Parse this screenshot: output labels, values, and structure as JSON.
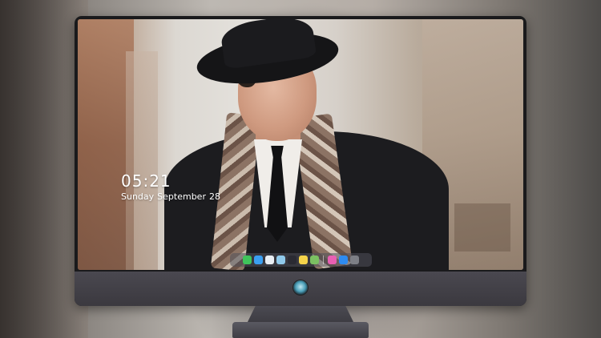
{
  "lockscreen": {
    "time": "05:21",
    "date_day": "Sunday",
    "date_month": "September",
    "date_num": "28"
  },
  "dock": {
    "icons": [
      {
        "name": "messages-icon",
        "color": "#3fc45b"
      },
      {
        "name": "finder-icon",
        "color": "#3b9ff0"
      },
      {
        "name": "safari-icon",
        "color": "#e9eef3"
      },
      {
        "name": "preview-icon",
        "color": "#8fc9ea"
      },
      {
        "name": "clapper-icon",
        "color": "#2b2b33"
      },
      {
        "name": "notes-icon",
        "color": "#f4d34a"
      },
      {
        "name": "photos-icon",
        "color": "#7bc062"
      },
      {
        "name": "itunes-icon",
        "color": "#e85fb3"
      },
      {
        "name": "appstore-icon",
        "color": "#2e8bf0"
      },
      {
        "name": "camera-icon",
        "color": "#7d7f86"
      }
    ]
  }
}
